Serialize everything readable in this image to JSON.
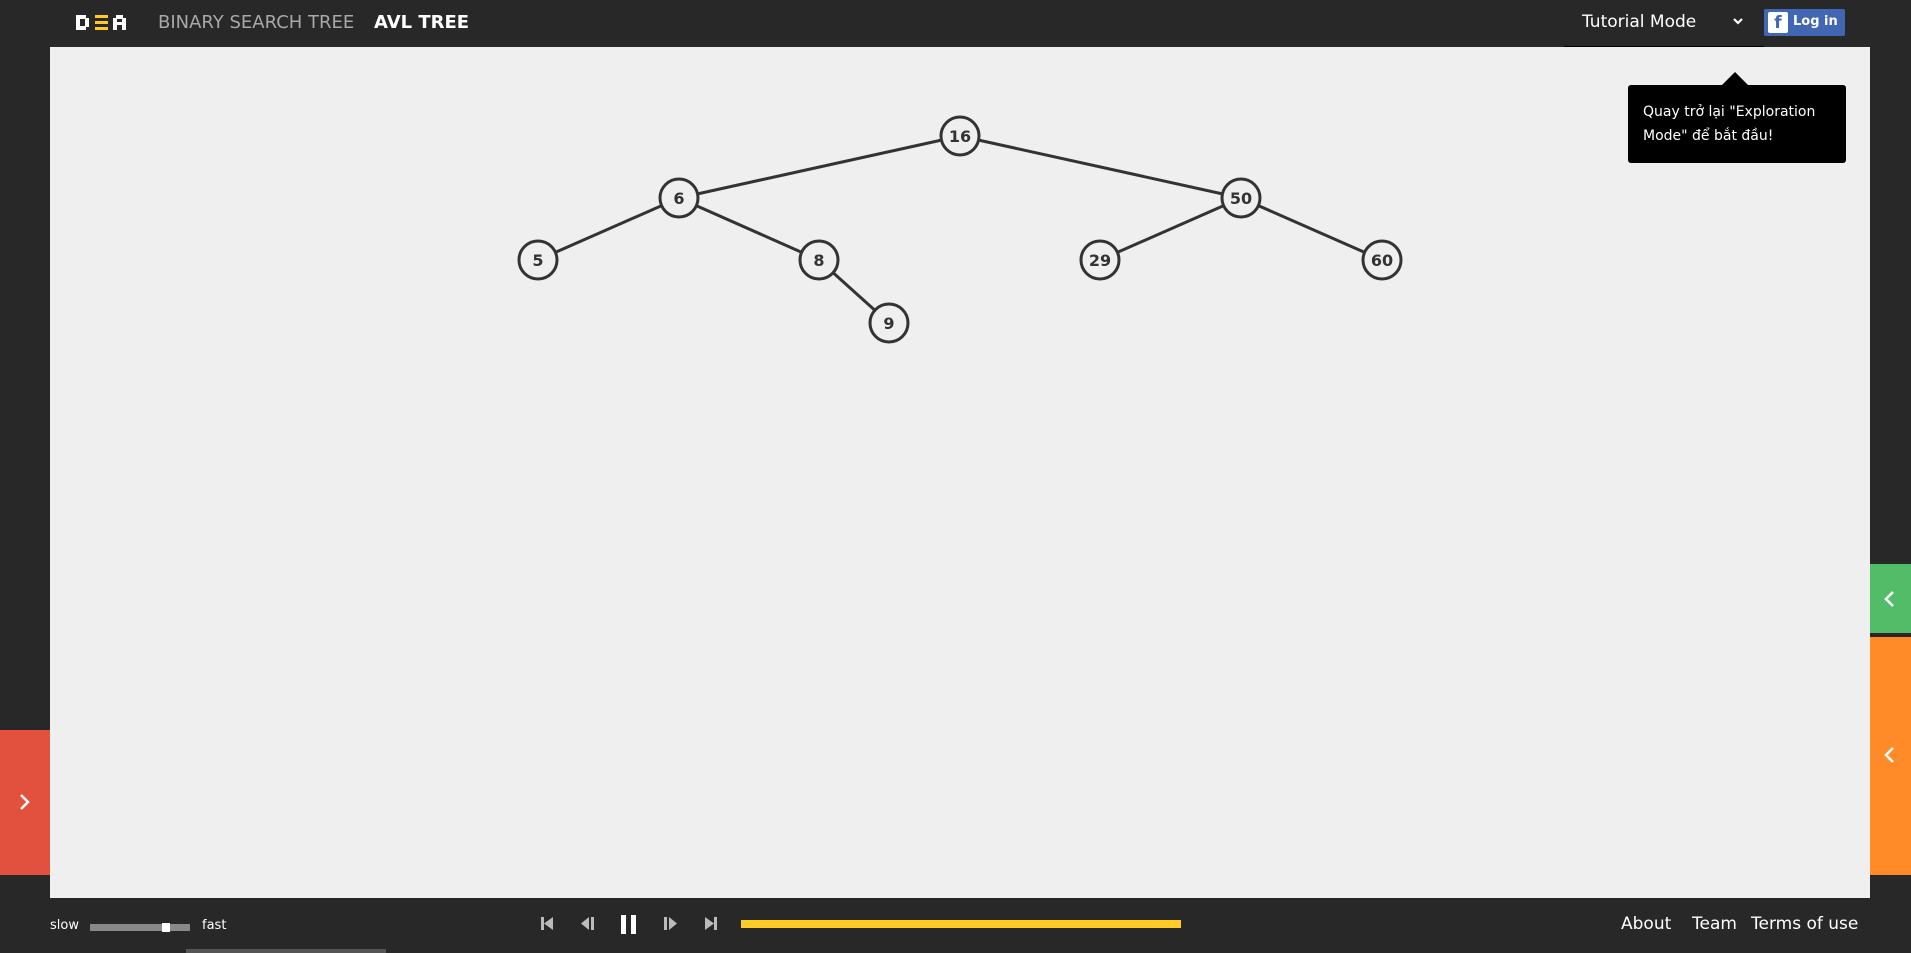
{
  "app": {
    "logo_text": "DSA",
    "nav": [
      {
        "label": "BINARY SEARCH TREE",
        "active": false
      },
      {
        "label": "AVL TREE",
        "active": true
      }
    ],
    "mode": {
      "selected": "Tutorial Mode"
    },
    "login": {
      "label": "Log in",
      "icon": "facebook-icon"
    }
  },
  "tooltip": {
    "text": "Quay trở lại \"Exploration Mode\" để bắt đầu!"
  },
  "tree": {
    "nodes": [
      {
        "id": "n16",
        "label": "16"
      },
      {
        "id": "n6",
        "label": "6"
      },
      {
        "id": "n50",
        "label": "50"
      },
      {
        "id": "n5",
        "label": "5"
      },
      {
        "id": "n8",
        "label": "8"
      },
      {
        "id": "n29",
        "label": "29"
      },
      {
        "id": "n60",
        "label": "60"
      },
      {
        "id": "n9",
        "label": "9"
      }
    ],
    "edges": [
      [
        "n16",
        "n6"
      ],
      [
        "n16",
        "n50"
      ],
      [
        "n6",
        "n5"
      ],
      [
        "n6",
        "n8"
      ],
      [
        "n50",
        "n29"
      ],
      [
        "n50",
        "n60"
      ],
      [
        "n8",
        "n9"
      ]
    ]
  },
  "controls": {
    "speed": {
      "slow_label": "slow",
      "fast_label": "fast",
      "value": 0.78
    },
    "progress": 1.0,
    "buttons": [
      "skip-to-start-icon",
      "step-back-icon",
      "pause-icon",
      "step-forward-icon",
      "skip-to-end-icon"
    ]
  },
  "footer": {
    "about": "About",
    "team": "Team",
    "terms": "Terms of use"
  },
  "colors": {
    "background": "#282828",
    "canvas": "#efefef",
    "progress": "#ffcb26",
    "green_tab": "#52bc69",
    "orange_tab": "#ff8a27",
    "red_tab": "#e2513e",
    "facebook": "#4267b2"
  }
}
